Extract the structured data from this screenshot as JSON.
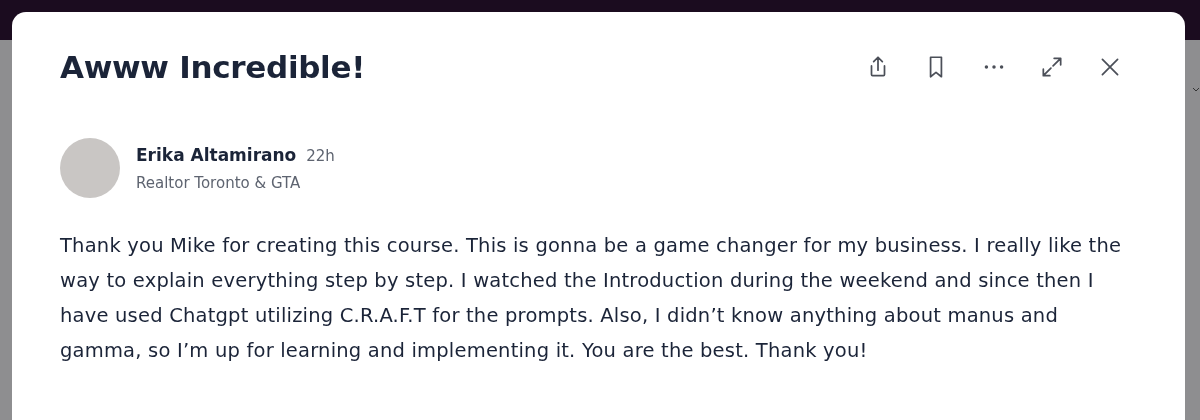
{
  "dialog": {
    "title": "Awww Incredible!",
    "author": {
      "name": "Erika Altamirano",
      "time": "22h",
      "headline": "Realtor Toronto & GTA"
    },
    "body": "Thank you Mike for creating this course. This is gonna be a game changer for my business. I really like the way to explain everything step by step. I watched the Introduction during the weekend and since then I have used Chatgpt utilizing C.R.A.F.T for the prompts. Also, I didn’t know anything about manus and gamma, so I’m up for learning and implementing it. You are the best. Thank you!"
  }
}
